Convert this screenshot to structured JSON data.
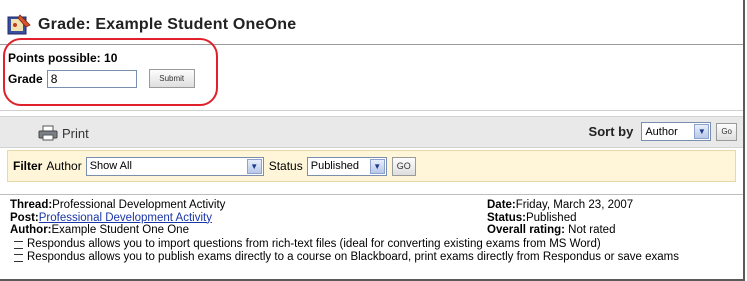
{
  "header": {
    "title": "Grade:  Example Student OneOne",
    "icon": "grade-book-icon"
  },
  "grade_form": {
    "points_label": "Points possible:",
    "points_value": "10",
    "grade_label": "Grade",
    "grade_value": "8",
    "submit_label": "Submit",
    "highlight_color": "#e0202a"
  },
  "toolbar": {
    "print_label": "Print",
    "print_icon": "printer-icon",
    "sort_label": "Sort by",
    "sort_value": "Author",
    "go_label": "Go"
  },
  "filter": {
    "filter_label": "Filter",
    "author_label": "Author",
    "author_value": "Show All",
    "status_label": "Status",
    "status_value": "Published",
    "go_label": "GO"
  },
  "post": {
    "thread_label": "Thread:",
    "thread_value": "Professional Development Activity",
    "post_label": "Post:",
    "post_value": "Professional Development Activity",
    "author_label": "Author:",
    "author_value": "Example Student One One",
    "date_label": "Date:",
    "date_value": "Friday, March 23, 2007",
    "status_label": "Status:",
    "status_value": "Published",
    "rating_label": "Overall rating:",
    "rating_value": " Not rated",
    "bullets": [
      "Respondus allows you to import questions from rich-text files (ideal for converting existing exams from MS Word)",
      "Respondus allows you to publish exams directly to a course on Blackboard, print exams directly from Respondus or save exams"
    ]
  }
}
